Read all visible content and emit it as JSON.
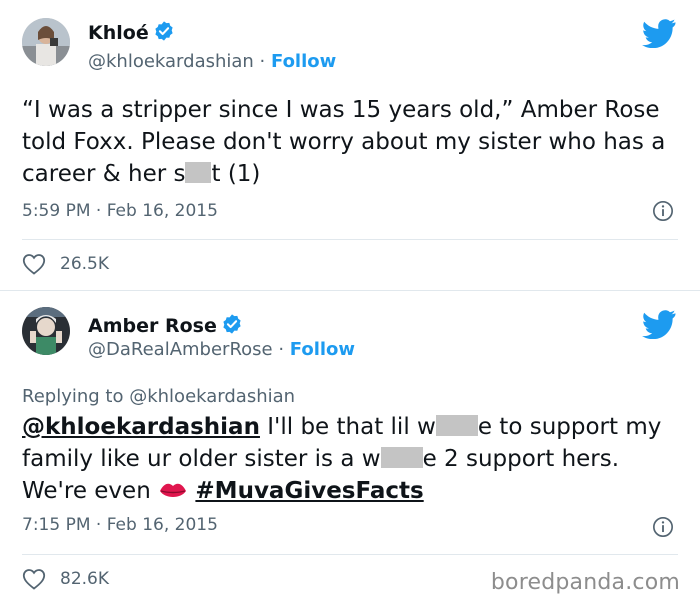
{
  "tweets": [
    {
      "display_name": "Khloé",
      "handle": "@khloekardashian",
      "follow_label": "Follow",
      "text_segments": [
        "“I was a stripper since I was 15 years old,” Amber Rose told Foxx. Please don't worry about my sister who has a career & her s",
        "t (1)"
      ],
      "timestamp": "5:59 PM · Feb 16, 2015",
      "likes": "26.5K"
    },
    {
      "display_name": "Amber Rose",
      "handle": "@DaRealAmberRose",
      "follow_label": "Follow",
      "replying_to_label": "Replying to",
      "replying_to_handle": "@khloekardashian",
      "mention": "@khloekardashian",
      "text_segments": [
        " I'll be that lil w",
        "e to support my family like ur older sister is a w",
        "e 2 support hers. We're even "
      ],
      "hashtag": "#MuvaGivesFacts",
      "timestamp": "7:15 PM · Feb 16, 2015",
      "likes": "82.6K"
    }
  ],
  "watermark": "boredpanda.com",
  "colors": {
    "verified_blue": "#1d9bf0",
    "follow_blue": "#1d9bf0",
    "secondary_text": "#536471",
    "censor_gray": "#c4c4c4"
  },
  "icons": [
    "verified-badge-icon",
    "twitter-bird-icon",
    "info-icon",
    "heart-icon",
    "kiss-lips-icon"
  ]
}
